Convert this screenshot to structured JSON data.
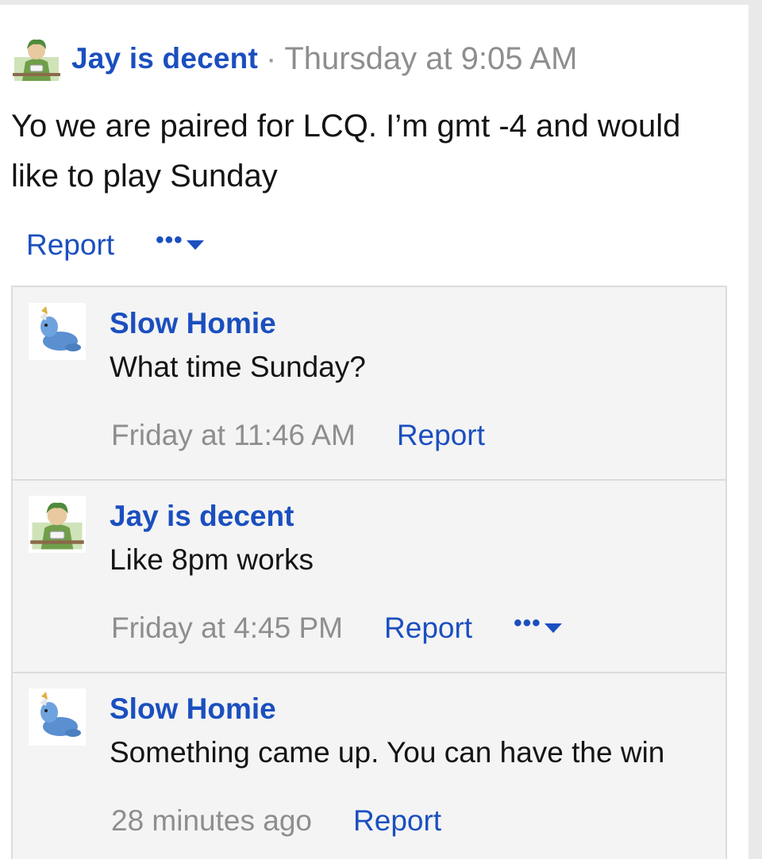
{
  "post": {
    "author": "Jay is decent",
    "separator": "·",
    "time": "Thursday at 9:05 AM",
    "body": "Yo we are paired for LCQ. I’m gmt -4 and would like to play Sunday",
    "avatar_icon": "zoro-eating-avatar-icon",
    "actions": {
      "report": "Report",
      "more": "•••"
    }
  },
  "comments": [
    {
      "author": "Slow Homie",
      "avatar_icon": "seal-pokemon-avatar-icon",
      "text": "What time Sunday?",
      "time": "Friday at 11:46 AM",
      "report": "Report",
      "has_more": false
    },
    {
      "author": "Jay is decent",
      "avatar_icon": "zoro-eating-avatar-icon",
      "text": "Like 8pm works",
      "time": "Friday at 4:45 PM",
      "report": "Report",
      "has_more": true,
      "more": "•••"
    },
    {
      "author": "Slow Homie",
      "avatar_icon": "seal-pokemon-avatar-icon",
      "text": "Something came up. You can have the win",
      "time": "28 minutes ago",
      "report": "Report",
      "has_more": false
    }
  ],
  "colors": {
    "link": "#1b4fbf",
    "muted": "#8e8e8e",
    "text": "#141414",
    "comment_bg": "#f4f4f4",
    "border": "#dcdcdc"
  }
}
